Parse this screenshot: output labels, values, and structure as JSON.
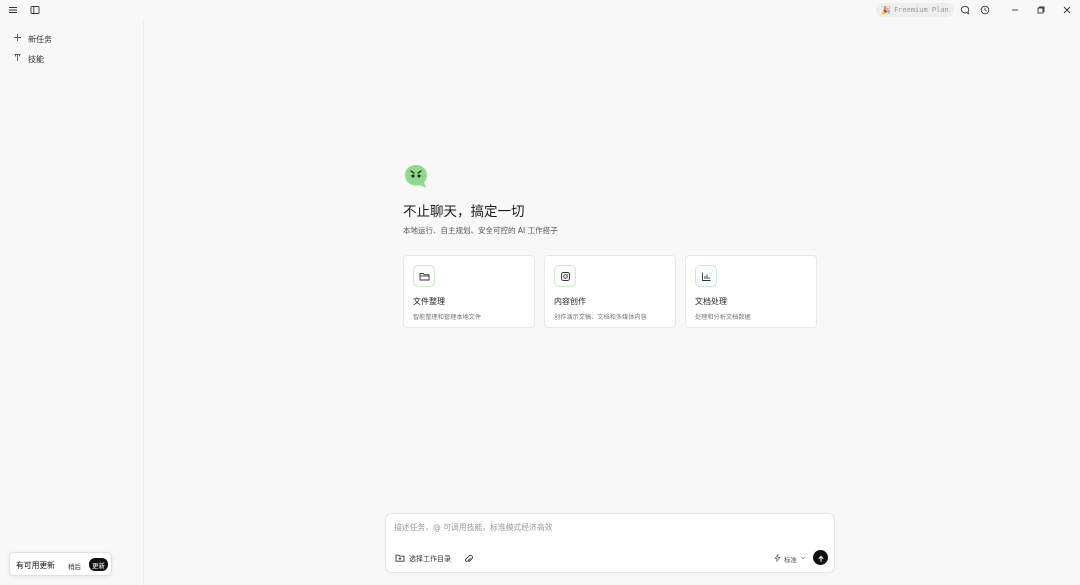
{
  "titlebar": {
    "plan_label": "Freemium Plan",
    "icons": [
      "menu-icon",
      "sidebar-toggle-icon",
      "chat-icon",
      "clock-icon",
      "minimize-icon",
      "restore-icon",
      "close-icon"
    ]
  },
  "sidebar": {
    "items": [
      {
        "label": "新任务",
        "icon": "plus-icon"
      },
      {
        "label": "技能",
        "icon": "skill-icon"
      }
    ]
  },
  "hero": {
    "title": "不止聊天，搞定一切",
    "subtitle": "本地运行、自主规划、安全可控的 AI 工作搭子"
  },
  "cards": [
    {
      "title": "文件整理",
      "desc": "智能整理和管理本地文件",
      "icon": "folder-icon"
    },
    {
      "title": "内容创作",
      "desc": "创作演示文稿、文档和多媒体内容",
      "icon": "camera-icon"
    },
    {
      "title": "文档处理",
      "desc": "处理和分析文档数据",
      "icon": "bar-chart-icon"
    }
  ],
  "composer": {
    "placeholder": "描述任务，@ 可调用技能，标准模式经济高效",
    "workdir_label": "选择工作目录",
    "mode_label": "标准"
  },
  "update_toast": {
    "text": "有可用更新",
    "later_label": "稍后",
    "update_label": "更新"
  },
  "colors": {
    "accent": "#111111",
    "logo_green": "#8ed98a",
    "card_icon_border": "#cfe8cf"
  }
}
